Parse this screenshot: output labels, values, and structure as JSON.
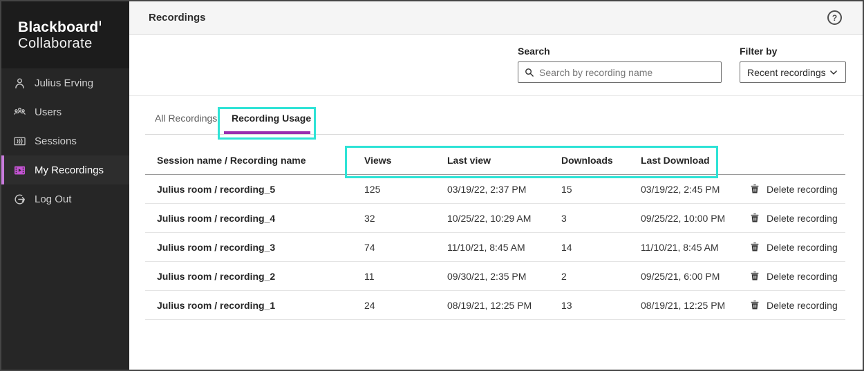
{
  "logo": {
    "line1": "Blackboard",
    "line2": "Collaborate"
  },
  "sidebar": {
    "items": [
      {
        "label": "Julius Erving",
        "icon": "person-icon",
        "active": false
      },
      {
        "label": "Users",
        "icon": "users-icon",
        "active": false
      },
      {
        "label": "Sessions",
        "icon": "sessions-icon",
        "active": false
      },
      {
        "label": "My Recordings",
        "icon": "recordings-icon",
        "active": true
      },
      {
        "label": "Log Out",
        "icon": "logout-icon",
        "active": false
      }
    ]
  },
  "header": {
    "title": "Recordings",
    "help_glyph": "?"
  },
  "search": {
    "label": "Search",
    "placeholder": "Search by recording name"
  },
  "filter": {
    "label": "Filter by",
    "value": "Recent recordings"
  },
  "tabs": [
    {
      "label": "All Recordings",
      "active": false
    },
    {
      "label": "Recording Usage",
      "active": true
    }
  ],
  "table": {
    "columns": [
      "Session name / Recording name",
      "Views",
      "Last view",
      "Downloads",
      "Last Download"
    ],
    "rows": [
      {
        "name": "Julius room / recording_5",
        "views": "125",
        "last_view": "03/19/22, 2:37 PM",
        "downloads": "15",
        "last_download": "03/19/22, 2:45 PM",
        "action": "Delete recording"
      },
      {
        "name": "Julius room / recording_4",
        "views": "32",
        "last_view": "10/25/22, 10:29 AM",
        "downloads": "3",
        "last_download": "09/25/22, 10:00 PM",
        "action": "Delete recording"
      },
      {
        "name": "Julius room / recording_3",
        "views": "74",
        "last_view": "11/10/21, 8:45 AM",
        "downloads": "14",
        "last_download": "11/10/21, 8:45 AM",
        "action": "Delete recording"
      },
      {
        "name": "Julius room / recording_2",
        "views": "11",
        "last_view": "09/30/21, 2:35 PM",
        "downloads": "2",
        "last_download": "09/25/21, 6:00 PM",
        "action": "Delete recording"
      },
      {
        "name": "Julius room / recording_1",
        "views": "24",
        "last_view": "08/19/21, 12:25 PM",
        "downloads": "13",
        "last_download": "08/19/21, 12:25 PM",
        "action": "Delete recording"
      }
    ]
  },
  "colors": {
    "accent-purple": "#9a2fb0",
    "sidebar-active-accent": "#c87bdc",
    "recordings-icon-purple": "#c353d2",
    "annotation-cyan": "#2ee3d6",
    "sidebar-bg": "#262626",
    "sidebar-logo-bg": "#1c1c1c",
    "sidebar-active-bg": "#2d2d2d",
    "topbar-bg": "#f5f5f5"
  }
}
